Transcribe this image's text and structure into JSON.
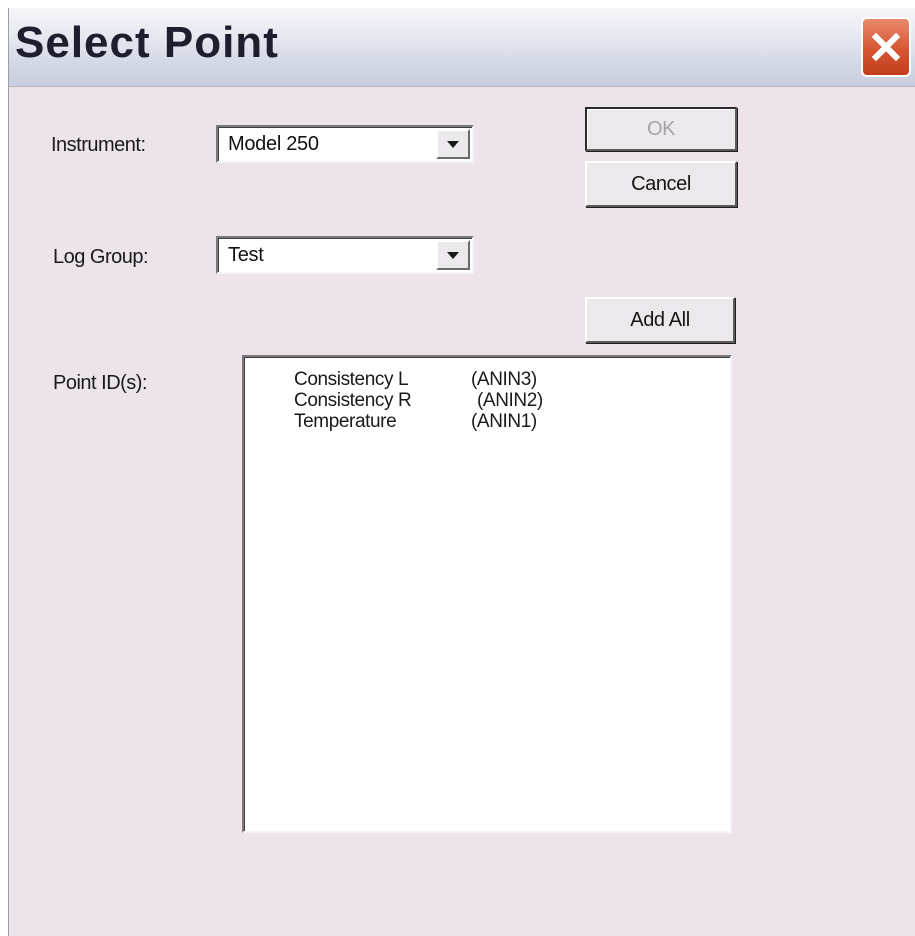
{
  "window": {
    "title": "Select Point",
    "close_icon": "close-icon",
    "accent_close": "#d65632"
  },
  "form": {
    "instrument_label": "Instrument:",
    "instrument_value": "Model 250",
    "log_group_label": "Log Group:",
    "log_group_value": "Test",
    "point_ids_label": "Point ID(s):"
  },
  "buttons": {
    "ok": "OK",
    "cancel": "Cancel",
    "add_all": "Add All"
  },
  "points": [
    {
      "name": "Consistency L",
      "id": "(ANIN3)"
    },
    {
      "name": "Consistency R",
      "id": "(ANIN2)"
    },
    {
      "name": "Temperature",
      "id": "(ANIN1)"
    }
  ]
}
